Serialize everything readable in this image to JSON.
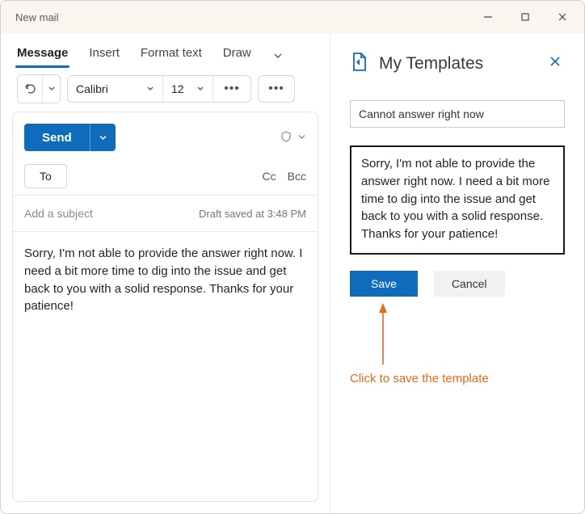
{
  "window": {
    "title": "New mail"
  },
  "tabs": {
    "message": "Message",
    "insert": "Insert",
    "format_text": "Format text",
    "draw": "Draw"
  },
  "format": {
    "font_name": "Calibri",
    "font_size": "12"
  },
  "compose": {
    "send_label": "Send",
    "to_label": "To",
    "cc_label": "Cc",
    "bcc_label": "Bcc",
    "subject_placeholder": "Add a subject",
    "draft_status": "Draft saved at 3:48 PM",
    "body": "Sorry, I'm not able to provide the answer right now. I need a bit more time to dig into the issue and get back to you with a solid response. Thanks for your patience!"
  },
  "templates": {
    "pane_title": "My Templates",
    "name_value": "Cannot answer right now",
    "body_value": " Sorry, I'm not able to provide the answer right now. I need a bit more time to dig into the issue and get back to you with a solid response. Thanks for your patience!",
    "save_label": "Save",
    "cancel_label": "Cancel"
  },
  "annotation": {
    "text": "Click to save the template"
  }
}
